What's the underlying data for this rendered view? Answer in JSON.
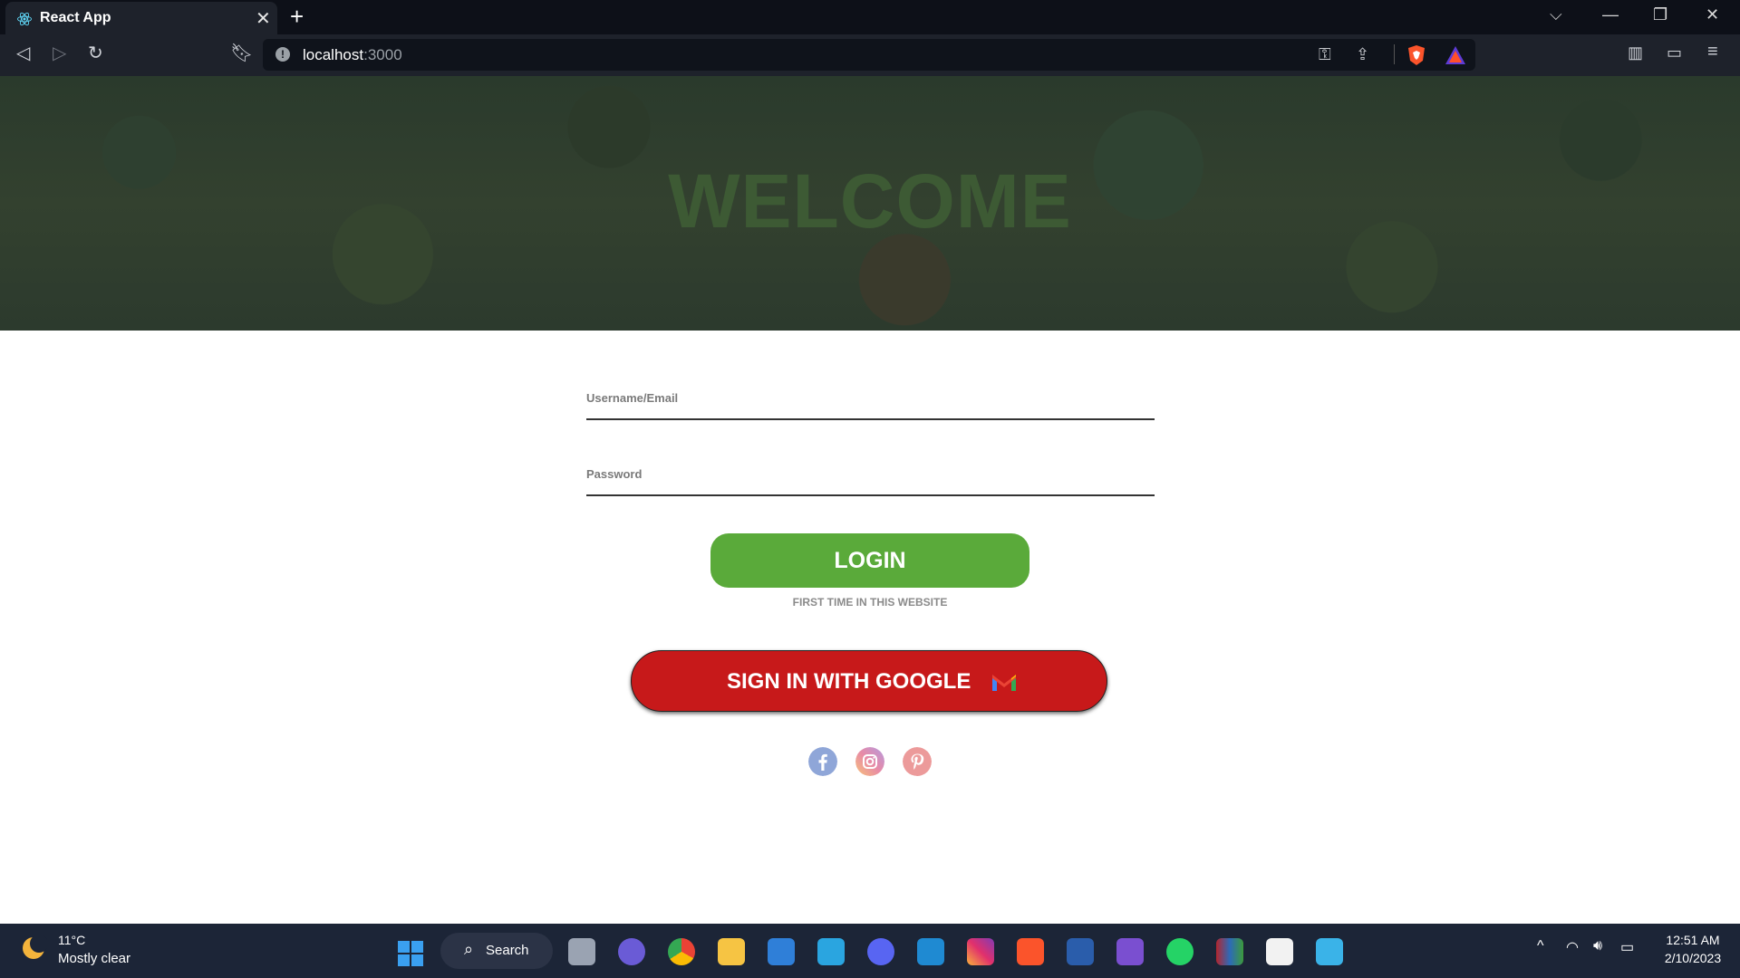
{
  "browser": {
    "tab_title": "React App",
    "url_host": "localhost",
    "url_port": ":3000"
  },
  "hero": {
    "title": "WELCOME"
  },
  "form": {
    "username_label": "Username/Email",
    "password_label": "Password",
    "login_label": "LOGIN",
    "first_time_text": "FIRST TIME IN THIS WEBSITE",
    "google_label": "SIGN IN WITH GOOGLE"
  },
  "social": [
    "facebook",
    "instagram",
    "pinterest"
  ],
  "taskbar": {
    "weather_temp": "11°C",
    "weather_desc": "Mostly clear",
    "search_label": "Search",
    "time": "12:51 AM",
    "date": "2/10/2023"
  },
  "colors": {
    "login": "#5aaa3a",
    "google": "#c7191a",
    "welcome": "#3d5a34"
  }
}
